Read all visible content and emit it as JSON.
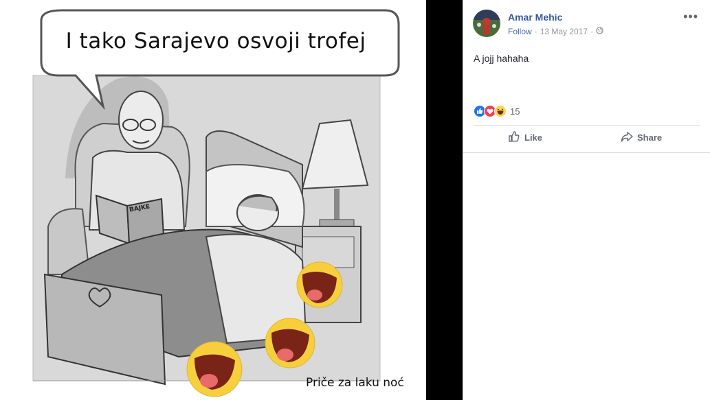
{
  "photo": {
    "bubble_text": "I tako Sarajevo osvoji trofej",
    "book_title": "BAJKE",
    "caption": "Priče za laku noć"
  },
  "post": {
    "author": "Amar Mehic",
    "follow_label": "Follow",
    "separator": "·",
    "date": "13 May 2017",
    "privacy_icon": "globe-icon",
    "more_icon": "more-options-icon",
    "text": "A jojj hahaha",
    "reactions": {
      "icons": [
        "like-reaction-icon",
        "love-reaction-icon",
        "haha-reaction-icon"
      ],
      "count": "15"
    },
    "actions": {
      "like_label": "Like",
      "share_label": "Share"
    }
  },
  "colors": {
    "link": "#365899",
    "follow": "#4267b2",
    "muted": "#90949c",
    "like_blue": "#1877f2",
    "love_red": "#f33e58",
    "haha_yellow": "#fcd34d"
  }
}
